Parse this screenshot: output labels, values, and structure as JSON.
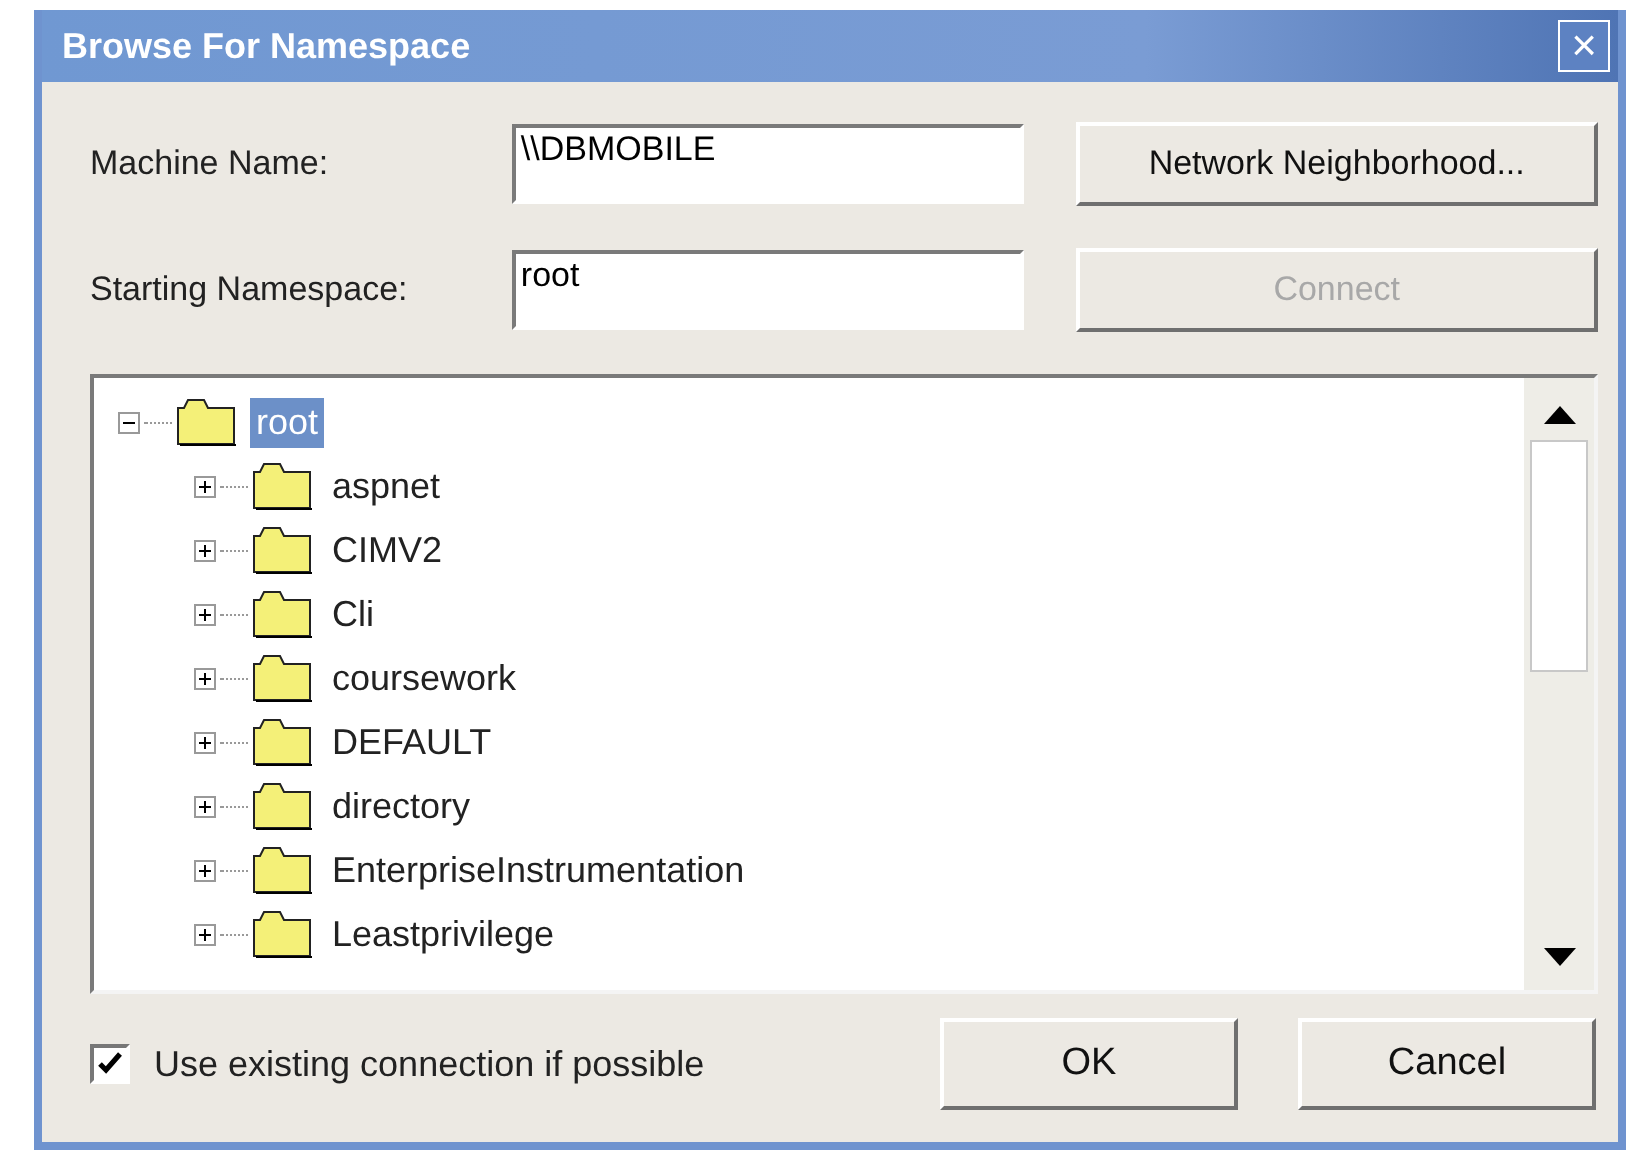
{
  "window": {
    "title": "Browse For Namespace",
    "close": "×"
  },
  "machine_name": {
    "label": "Machine Name:",
    "value": "\\\\DBMOBILE"
  },
  "starting_namespace": {
    "label": "Starting Namespace:",
    "value": "root"
  },
  "buttons_top": [
    {
      "label": "Network Neighborhood...",
      "disabled": false
    },
    {
      "label": "Connect",
      "disabled": true
    }
  ],
  "tree": {
    "items": [
      {
        "label": "root",
        "expanded": true,
        "selected": true,
        "children": [
          {
            "label": "aspnet",
            "expanded": false,
            "selected": false
          },
          {
            "label": "CIMV2",
            "expanded": false,
            "selected": false
          },
          {
            "label": "Cli",
            "expanded": false,
            "selected": false
          },
          {
            "label": "coursework",
            "expanded": false,
            "selected": false
          },
          {
            "label": "DEFAULT",
            "expanded": false,
            "selected": false
          },
          {
            "label": "directory",
            "expanded": false,
            "selected": false
          },
          {
            "label": "EnterpriseInstrumentation",
            "expanded": false,
            "selected": false
          },
          {
            "label": "Leastprivilege",
            "expanded": false,
            "selected": false
          }
        ]
      }
    ]
  },
  "use_existing": {
    "label": "Use existing connection if possible",
    "checked": true
  },
  "buttons": [
    {
      "label": "OK"
    },
    {
      "label": "Cancel"
    }
  ]
}
